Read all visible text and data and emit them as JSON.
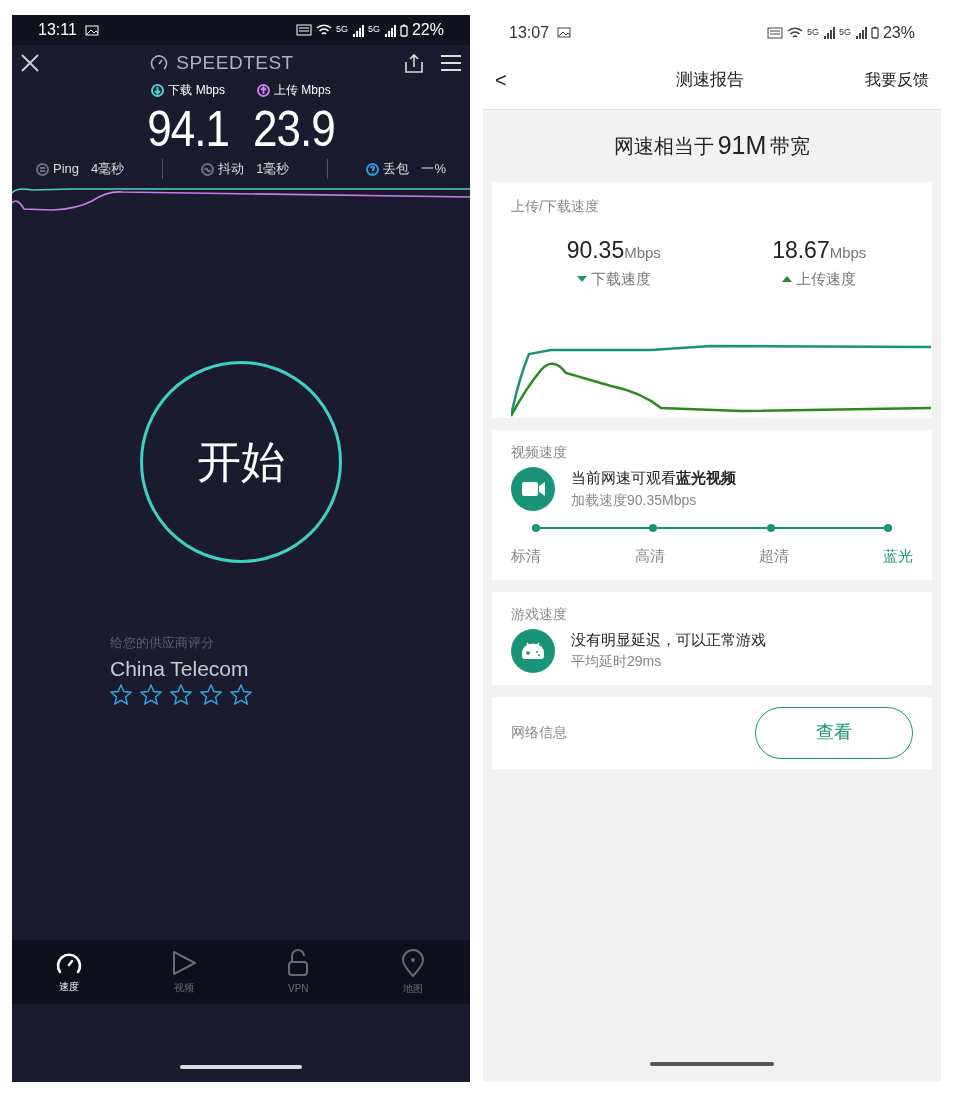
{
  "speedtest": {
    "status_bar": {
      "time": "13:11",
      "signals": [
        "5G",
        "5G"
      ],
      "battery": "22%"
    },
    "header": {
      "title": "SPEEDTEST"
    },
    "results": [
      {
        "label": "下载 Mbps",
        "value": "94.1",
        "color": "#4fd1c5"
      },
      {
        "label": "上传 Mbps",
        "value": "23.9",
        "color": "#c77dea"
      }
    ],
    "metrics": [
      {
        "label": "Ping",
        "value": "4毫秒",
        "color": "#6b6f80"
      },
      {
        "label": "抖动",
        "value": "1毫秒",
        "color": "#6b6f80"
      },
      {
        "label": "丢包",
        "value": "一%",
        "color": "#2f9be0"
      }
    ],
    "start_button": "开始",
    "rating": {
      "prompt": "给您的供应商评分",
      "provider": "China Telecom",
      "stars": 0
    },
    "nav": [
      {
        "label": "速度",
        "selected": true
      },
      {
        "label": "视频",
        "selected": false
      },
      {
        "label": "VPN",
        "selected": false
      },
      {
        "label": "地图",
        "selected": false
      }
    ]
  },
  "report": {
    "status_bar": {
      "time": "13:07",
      "signals": [
        "5G",
        "5G"
      ],
      "battery": "23%"
    },
    "header": {
      "back": "<",
      "title": "测速报告",
      "action": "我要反馈"
    },
    "summary": {
      "prefix": "网速相当于",
      "value": "91M",
      "suffix": "带宽"
    },
    "speed_card": {
      "title": "上传/下载速度",
      "items": [
        {
          "value": "90.35",
          "unit": "Mbps",
          "label": "下载速度",
          "kind": "down"
        },
        {
          "value": "18.67",
          "unit": "Mbps",
          "label": "上传速度",
          "kind": "up"
        }
      ]
    },
    "video_card": {
      "title": "视频速度",
      "headline": "当前网速可观看**蓝光视频**",
      "detail": "加载速度90.35Mbps",
      "levels": [
        {
          "label": "标清",
          "selected": false
        },
        {
          "label": "高清",
          "selected": false
        },
        {
          "label": "超清",
          "selected": false
        },
        {
          "label": "蓝光",
          "selected": true
        }
      ]
    },
    "game_card": {
      "title": "游戏速度",
      "headline": "没有明显延迟，可以正常游戏",
      "detail": "平均延时29ms"
    },
    "network_card": {
      "title": "网络信息",
      "button": "查看"
    }
  }
}
